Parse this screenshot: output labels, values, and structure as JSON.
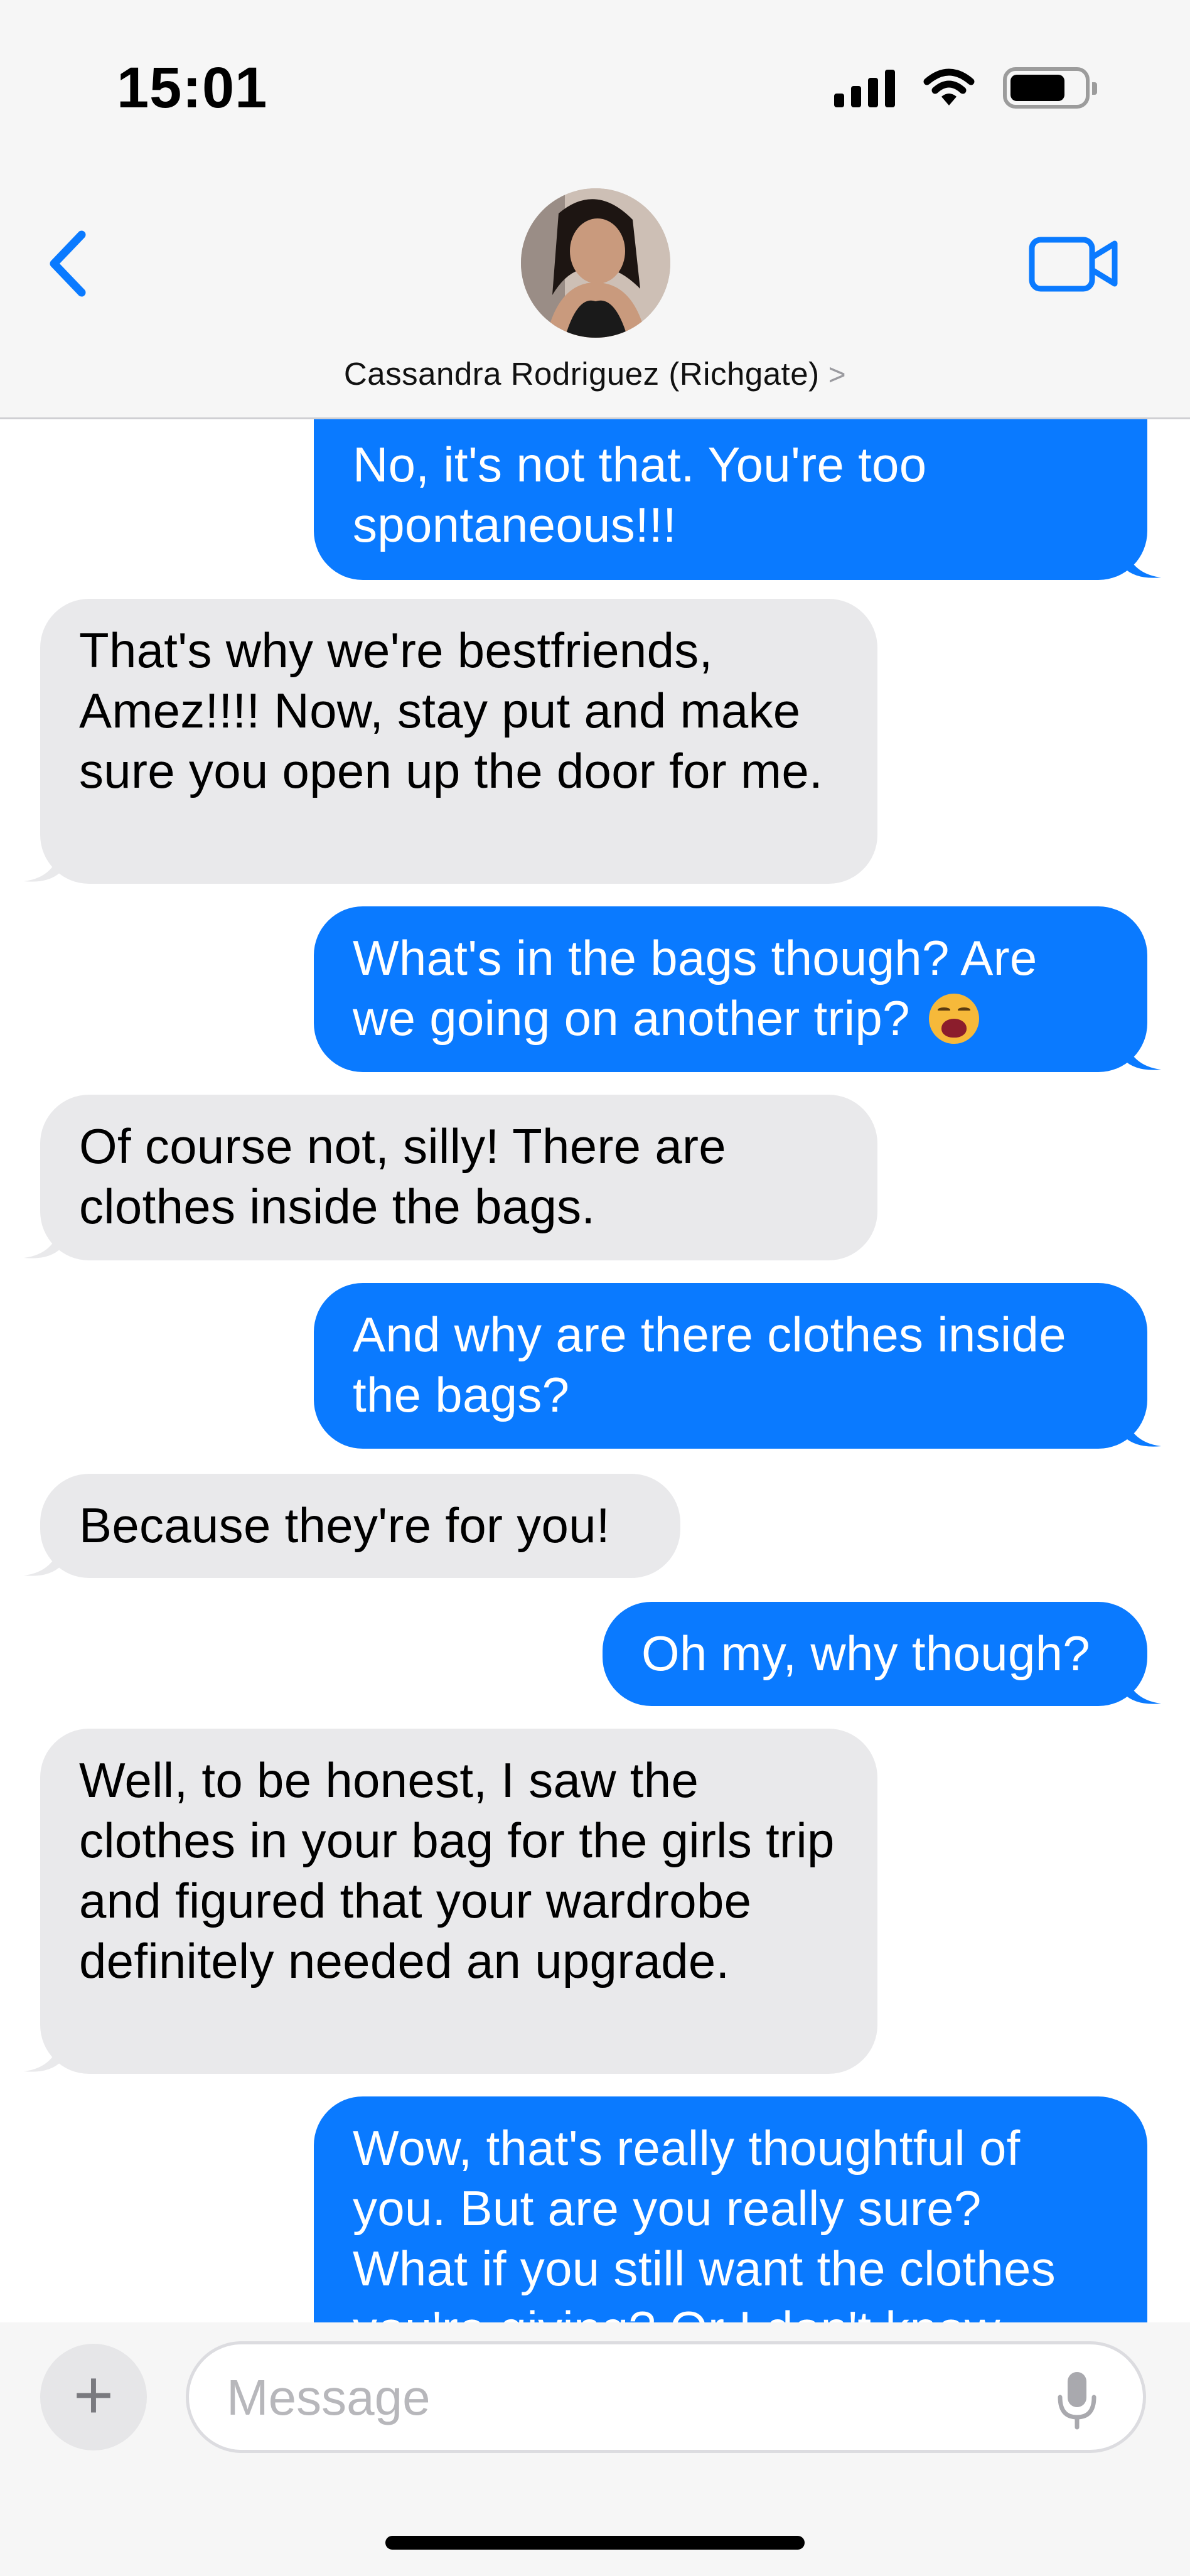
{
  "status_bar": {
    "time": "15:01"
  },
  "header": {
    "contact_name": "Cassandra Rodriguez (Richgate)",
    "contact_chevron": ">"
  },
  "messages": [
    {
      "from": "me",
      "text": "No, it's not that. You're too spontaneous!!!"
    },
    {
      "from": "them",
      "text": "That's why we're bestfriends, Amez!!!! Now, stay put and make sure you open up the door for me."
    },
    {
      "from": "me",
      "text": "What's in the bags though? Are we going on another trip?",
      "emoji": "weary-face"
    },
    {
      "from": "them",
      "text": "Of course not, silly! There are clothes inside the bags."
    },
    {
      "from": "me",
      "text": "And why are there clothes inside the bags?"
    },
    {
      "from": "them",
      "text": "Because they're for you!"
    },
    {
      "from": "me",
      "text": "Oh my, why though?"
    },
    {
      "from": "them",
      "text": "Well, to be honest, I saw the clothes in your bag for the girls trip and figured that your wardrobe definitely needed an upgrade."
    },
    {
      "from": "me",
      "text": "Wow, that's really thoughtful of you. But are you really sure? What if you still want the clothes you're giving? Or I don't know"
    }
  ],
  "input_bar": {
    "plus_label": "+",
    "placeholder": "Message"
  },
  "colors": {
    "sent_bubble": "#0a7aff",
    "received_bubble": "#e9e9eb",
    "accent": "#0a7aff"
  },
  "icons": [
    "back-chevron-icon",
    "video-camera-icon",
    "signal-icon",
    "wifi-icon",
    "battery-icon",
    "microphone-icon"
  ]
}
